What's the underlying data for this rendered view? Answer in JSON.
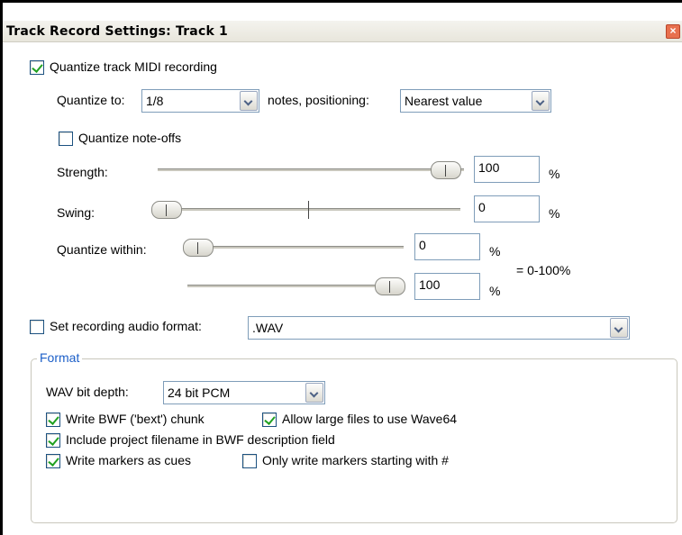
{
  "window": {
    "title": "Track Record Settings: Track 1",
    "close_glyph": "×"
  },
  "quantize": {
    "enable_label": "Quantize track MIDI recording",
    "quantize_to_label": "Quantize to:",
    "quantize_to_value": "1/8",
    "positioning_label": "notes, positioning:",
    "positioning_value": "Nearest value",
    "note_offs_label": "Quantize note-offs",
    "strength_label": "Strength:",
    "strength_value": "100",
    "strength_unit": "%",
    "swing_label": "Swing:",
    "swing_value": "0",
    "swing_unit": "%",
    "within_label": "Quantize within:",
    "within_min_value": "0",
    "within_min_unit": "%",
    "within_max_value": "100",
    "within_max_unit": "%",
    "within_range": "= 0-100%"
  },
  "record_format": {
    "set_format_label": "Set recording audio format:",
    "format_value": ".WAV"
  },
  "format_group": {
    "legend": "Format",
    "bit_depth_label": "WAV bit depth:",
    "bit_depth_value": "24 bit PCM",
    "write_bwf_label": "Write BWF ('bext') chunk",
    "allow_large_label": "Allow large files to use Wave64",
    "include_filename_label": "Include project filename in BWF description field",
    "write_markers_label": "Write markers as cues",
    "only_markers_label": "Only write markers starting with #"
  },
  "colors": {
    "accent": "#1c5fc8",
    "check": "#21a121",
    "close": "#e8704e"
  },
  "icons": {
    "close": "close-icon",
    "dropdown": "chevron-down-icon",
    "check": "checkmark-icon"
  }
}
